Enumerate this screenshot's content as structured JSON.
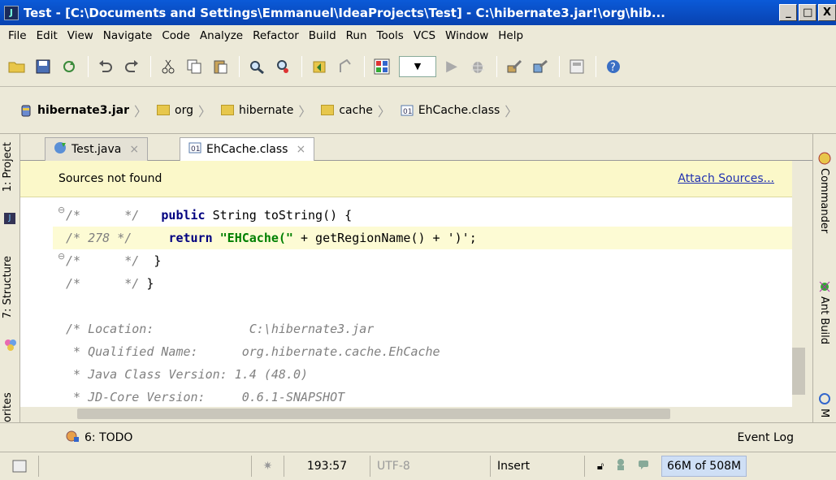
{
  "window": {
    "title": "Test - [C:\\Documents and Settings\\Emmanuel\\IdeaProjects\\Test] - C:\\hibernate3.jar!\\org\\hib...",
    "minimize": "_",
    "maximize": "□",
    "close": "X"
  },
  "menu": [
    "File",
    "Edit",
    "View",
    "Navigate",
    "Code",
    "Analyze",
    "Refactor",
    "Build",
    "Run",
    "Tools",
    "VCS",
    "Window",
    "Help"
  ],
  "breadcrumb": [
    {
      "label": "hibernate3.jar",
      "icon": "jar-icon"
    },
    {
      "label": "org",
      "icon": "folder-icon"
    },
    {
      "label": "hibernate",
      "icon": "folder-icon"
    },
    {
      "label": "cache",
      "icon": "folder-icon"
    },
    {
      "label": "EhCache.class",
      "icon": "class-file-icon"
    }
  ],
  "left_stripe": {
    "project": "1: Project",
    "structure": "7: Structure",
    "favorites": "orites"
  },
  "right_stripe": {
    "commander": "Commander",
    "ant": "Ant Build",
    "maven": "M"
  },
  "tabs": [
    {
      "label": "Test.java",
      "close": "×"
    },
    {
      "label": "EhCache.class",
      "close": "×"
    }
  ],
  "notification": {
    "text": "Sources not found",
    "link": "Attach Sources..."
  },
  "code": [
    {
      "comment": "/*      */",
      "kw": "public",
      "rest": " String toString() {",
      "highlight": false
    },
    {
      "comment": "/* 278 */",
      "kw": "return",
      "str": "\"EHCache(\"",
      "rest": " + getRegionName() + ')';",
      "highlight": true
    },
    {
      "comment": "/*      */",
      "rest": "  }",
      "highlight": false
    },
    {
      "comment": "/*      */",
      "rest": " }",
      "highlight": false
    },
    {
      "text": "",
      "highlight": false
    },
    {
      "text": "/* Location:             C:\\hibernate3.jar"
    },
    {
      "text": " * Qualified Name:      org.hibernate.cache.EhCache"
    },
    {
      "text": " * Java Class Version: 1.4 (48.0)"
    },
    {
      "text": " * JD-Core Version:     0.6.1-SNAPSHOT"
    }
  ],
  "toolwindows": {
    "todo": "6: TODO",
    "event_log": "Event Log"
  },
  "status": {
    "position": "193:57",
    "encoding": "UTF-8",
    "mode": "Insert",
    "memory": "66M of 508M"
  }
}
